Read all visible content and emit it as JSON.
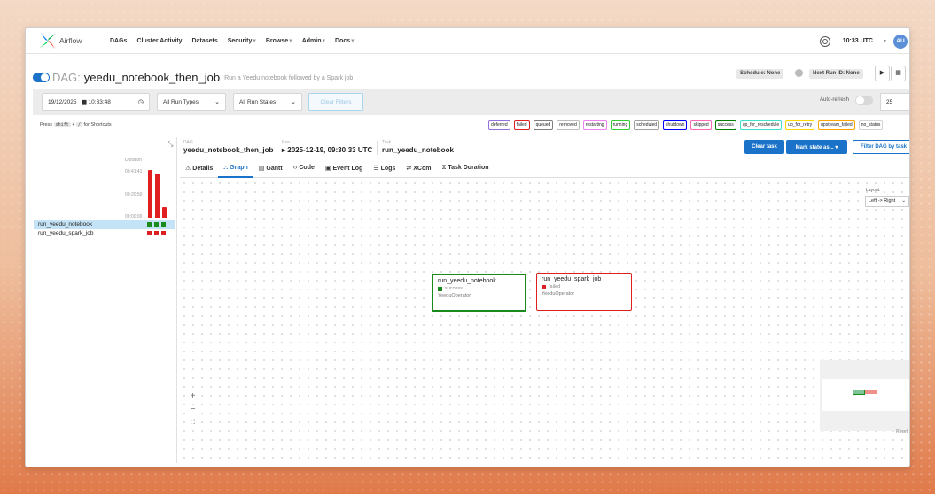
{
  "nav": {
    "brand": "Airflow",
    "items": [
      {
        "label": "DAGs",
        "dropdown": false
      },
      {
        "label": "Cluster Activity",
        "dropdown": false
      },
      {
        "label": "Datasets",
        "dropdown": false
      },
      {
        "label": "Security",
        "dropdown": true
      },
      {
        "label": "Browse",
        "dropdown": true
      },
      {
        "label": "Admin",
        "dropdown": true
      },
      {
        "label": "Docs",
        "dropdown": true
      }
    ],
    "time": "10:33 UTC",
    "user_initials": "AU"
  },
  "dag": {
    "prefix": "DAG:",
    "name": "yeedu_notebook_then_job",
    "description": "Run a Yeedu notebook followed by a Spark job",
    "schedule": "Schedule: None",
    "next_run": "Next Run ID: None"
  },
  "filters": {
    "date": "19/12/2025",
    "time": "10:33:48",
    "run_types": "All Run Types",
    "run_states": "All Run States",
    "clear": "Clear Filters",
    "auto_refresh": "Auto-refresh",
    "page_size": "25"
  },
  "shortcut": {
    "press": "Press",
    "key1": "shift",
    "plus": "+",
    "key2": "/",
    "suffix": "for Shortcuts"
  },
  "legend": [
    {
      "label": "deferred",
      "color": "#9370db"
    },
    {
      "label": "failed",
      "color": "#e02020"
    },
    {
      "label": "queued",
      "color": "#808080"
    },
    {
      "label": "removed",
      "color": "#bdbdbd"
    },
    {
      "label": "restarting",
      "color": "#ee82ee"
    },
    {
      "label": "running",
      "color": "#32cd32"
    },
    {
      "label": "scheduled",
      "color": "#a0a0a0"
    },
    {
      "label": "shutdown",
      "color": "#0000ff"
    },
    {
      "label": "skipped",
      "color": "#ff69b4"
    },
    {
      "label": "success",
      "color": "#008000"
    },
    {
      "label": "up_for_reschedule",
      "color": "#40e0d0"
    },
    {
      "label": "up_for_retry",
      "color": "#ffd700"
    },
    {
      "label": "upstream_failed",
      "color": "#ffa500"
    },
    {
      "label": "no_status",
      "color": "#d3d3d3"
    }
  ],
  "grid": {
    "duration_label": "Duration",
    "ticks": [
      "00:41:41",
      "00:20:50",
      "00:00:00"
    ],
    "runs": [
      {
        "duration_fraction": 1.0,
        "color": "#e02020"
      },
      {
        "duration_fraction": 0.92,
        "color": "#e02020"
      },
      {
        "duration_fraction": 0.22,
        "color": "#e02020"
      }
    ],
    "tasks": [
      {
        "name": "run_yeedu_notebook",
        "states": [
          "#1a8a1a",
          "#1a8a1a",
          "#1a8a1a"
        ]
      },
      {
        "name": "run_yeedu_spark_job",
        "states": [
          "#e02020",
          "#e02020",
          "#e02020"
        ]
      }
    ]
  },
  "detail": {
    "dag_label": "DAG",
    "dag_value": "yeedu_notebook_then_job",
    "run_label": "Run",
    "run_value": "▸ 2025-12-19, 09:30:33 UTC",
    "task_label": "Task",
    "task_value": "run_yeedu_notebook",
    "clear_task": "Clear task",
    "mark_state": "Mark state as... ▾",
    "filter_dag": "Filter DAG by task"
  },
  "tabs": [
    {
      "icon": "⚠",
      "label": "Details",
      "active": false
    },
    {
      "icon": "⛬",
      "label": "Graph",
      "active": true
    },
    {
      "icon": "▤",
      "label": "Gantt",
      "active": false
    },
    {
      "icon": "‹›",
      "label": "Code",
      "active": false
    },
    {
      "icon": "▣",
      "label": "Event Log",
      "active": false
    },
    {
      "icon": "☰",
      "label": "Logs",
      "active": false
    },
    {
      "icon": "⇄",
      "label": "XCom",
      "active": false
    },
    {
      "icon": "⧖",
      "label": "Task Duration",
      "active": false
    }
  ],
  "graph": {
    "layout_label": "Layout:",
    "layout_value": "Left -> Right",
    "nodes": [
      {
        "name": "run_yeedu_notebook",
        "state": "success",
        "operator": "YeeduOperator",
        "color": "#1a8a1a"
      },
      {
        "name": "run_yeedu_spark_job",
        "state": "failed",
        "operator": "YeeduOperator",
        "color": "#e02020"
      }
    ],
    "reset": "Reset"
  }
}
